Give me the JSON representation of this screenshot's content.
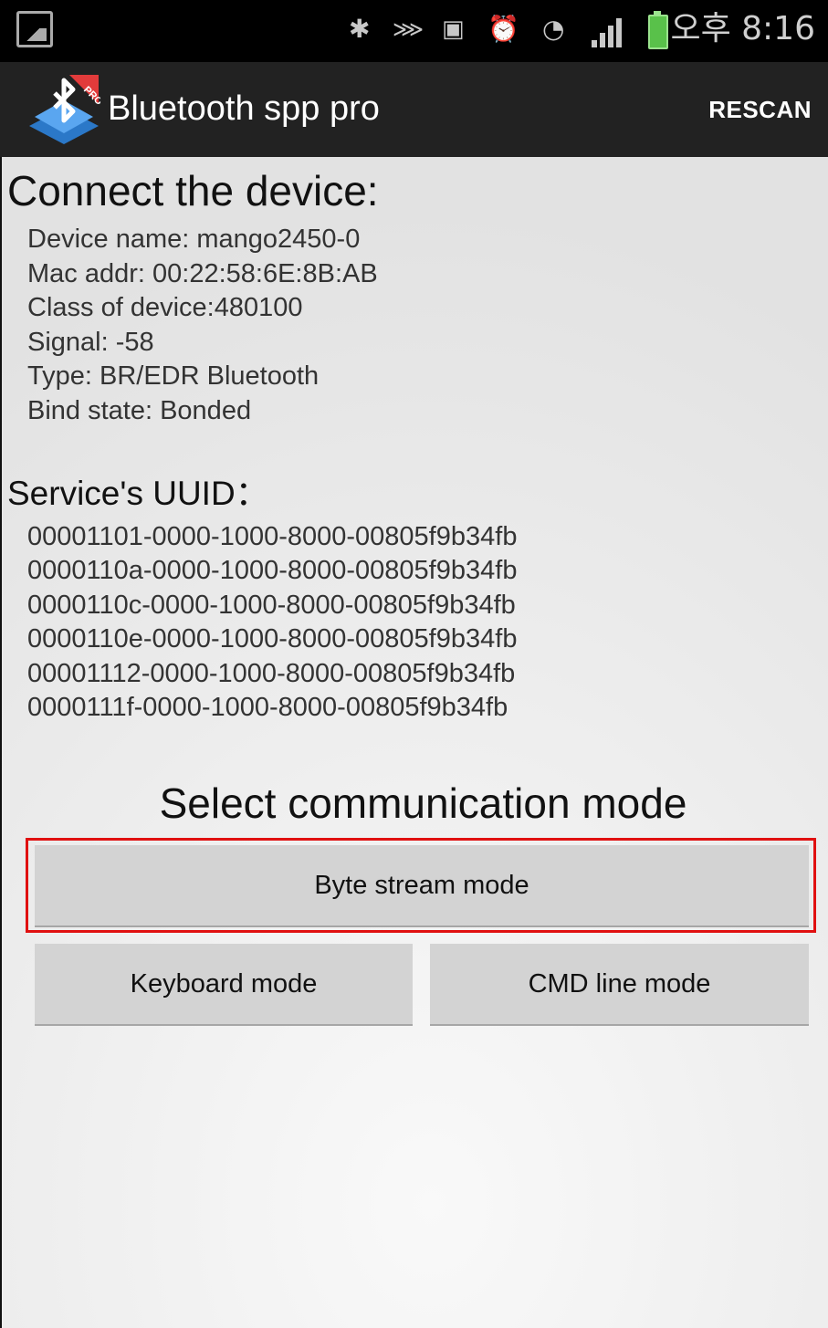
{
  "status_bar": {
    "time": "오후 8:16",
    "icons": [
      "gallery-icon",
      "bluetooth-icon",
      "nfc-icon",
      "screen-mirroring-icon",
      "alarm-icon",
      "wifi-icon",
      "signal-icon",
      "battery-charging-icon"
    ]
  },
  "action_bar": {
    "title": "Bluetooth spp pro",
    "logo_badge": "PRO",
    "rescan_label": "RESCAN"
  },
  "device": {
    "heading": "Connect the device:",
    "lines": [
      "Device name: mango2450-0",
      "Mac addr: 00:22:58:6E:8B:AB",
      "Class of device:480100",
      "Signal: -58",
      "Type: BR/EDR Bluetooth",
      "Bind state: Bonded"
    ]
  },
  "services": {
    "heading": "Service's UUID：",
    "uuids": [
      "00001101-0000-1000-8000-00805f9b34fb",
      "0000110a-0000-1000-8000-00805f9b34fb",
      "0000110c-0000-1000-8000-00805f9b34fb",
      "0000110e-0000-1000-8000-00805f9b34fb",
      "00001112-0000-1000-8000-00805f9b34fb",
      "0000111f-0000-1000-8000-00805f9b34fb"
    ]
  },
  "mode": {
    "heading": "Select communication mode",
    "byte_stream_label": "Byte stream mode",
    "keyboard_label": "Keyboard mode",
    "cmd_line_label": "CMD line mode"
  },
  "colors": {
    "action_bar_bg": "#222222",
    "status_bar_bg": "#000000",
    "button_bg": "#d3d3d3",
    "highlight_border": "#e01010",
    "battery": "#59c14a"
  }
}
